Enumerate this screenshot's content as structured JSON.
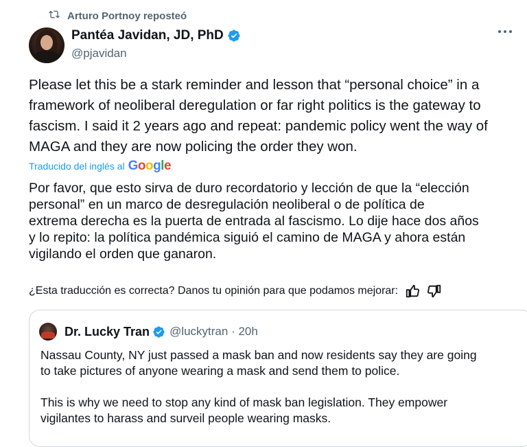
{
  "repost": {
    "text": "Arturo Portnoy reposteó",
    "icon": "repost-icon"
  },
  "author": {
    "name": "Pantéa Javidan, JD, PhD",
    "handle": "@pjavidan",
    "verified": true
  },
  "tweet": {
    "text": "Please let this be a stark reminder and lesson that “personal choice” in a\nframework of neoliberal deregulation or far right politics is the gateway to\nfascism. I said it 2 years ago and repeat: pandemic policy went the way of\nMAGA and they are now policing the order they won."
  },
  "translation": {
    "label": "Traducido del inglés al",
    "provider": "Google",
    "text": "Por favor, que esto sirva de duro recordatorio y lección de que la “elección\npersonal” en un marco de desregulación neoliberal o de política de\nextrema derecha es la puerta de entrada al fascismo. Lo dije hace dos años\ny lo repito: la política pandémica siguió el camino de MAGA y ahora están\nvigilando el orden que ganaron.",
    "feedback_prompt": "¿Esta traducción es correcta? Danos tu opinión para que podamos mejorar:"
  },
  "quote": {
    "name": "Dr. Lucky Tran",
    "handle": "@luckytran",
    "meta": "@luckytran · 20h",
    "text": "Nassau County, NY just passed a mask ban and now residents say they are going\nto take pictures of anyone wearing a mask and send them to police.\n\nThis is why we need to stop any kind of mask ban legislation. They empower\nvigilantes to harass and surveil people wearing masks."
  },
  "colors": {
    "verified": "#1d9bf0",
    "muted": "#536471",
    "link": "#1d9bf0",
    "border": "#cfd9de"
  }
}
